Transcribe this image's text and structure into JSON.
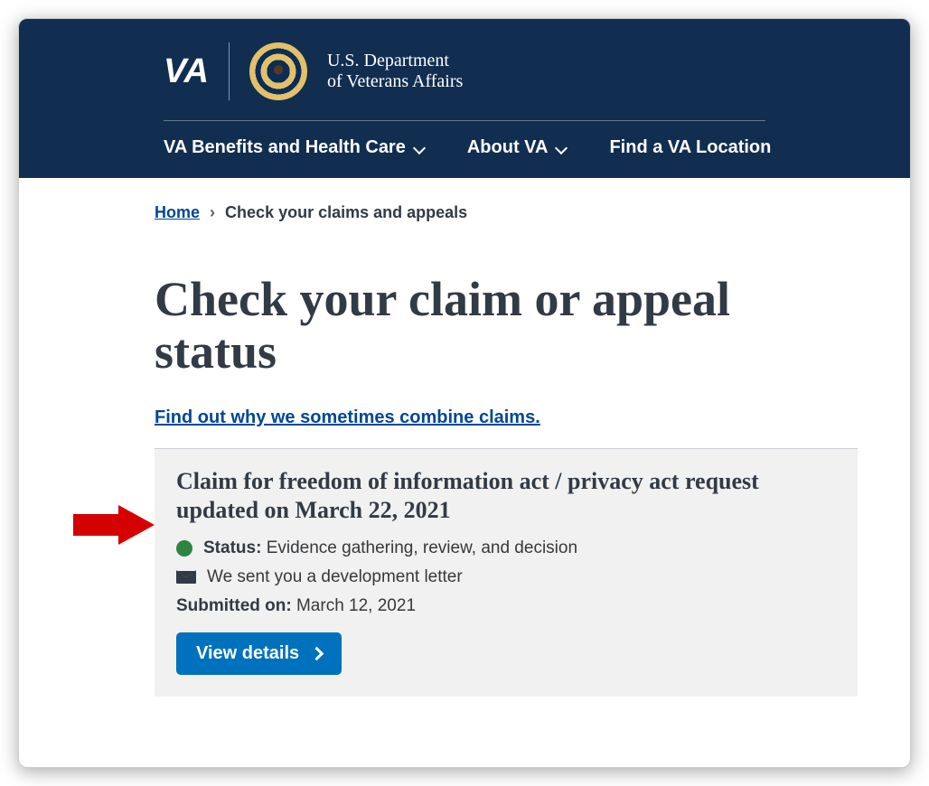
{
  "brand": {
    "wordmark": "VA",
    "dept_line1": "U.S. Department",
    "dept_line2": "of Veterans Affairs"
  },
  "nav": {
    "benefits": "VA Benefits and Health Care",
    "about": "About VA",
    "location": "Find a VA Location"
  },
  "breadcrumb": {
    "home": "Home",
    "current": "Check your claims and appeals"
  },
  "page": {
    "title": "Check your claim or appeal status",
    "combine_link": "Find out why we sometimes combine claims."
  },
  "claim": {
    "title": "Claim for freedom of information act / privacy act request updated on March 22, 2021",
    "status_label": "Status:",
    "status_value": "Evidence gathering, review, and decision",
    "mail_msg": "We sent you a development letter",
    "submitted_label": "Submitted on:",
    "submitted_value": "March 12, 2021",
    "view_label": "View details"
  },
  "colors": {
    "header_bg": "#112e51",
    "link": "#004795",
    "button": "#0071bc",
    "status_green": "#2e8540",
    "arrow_red": "#d50000"
  }
}
